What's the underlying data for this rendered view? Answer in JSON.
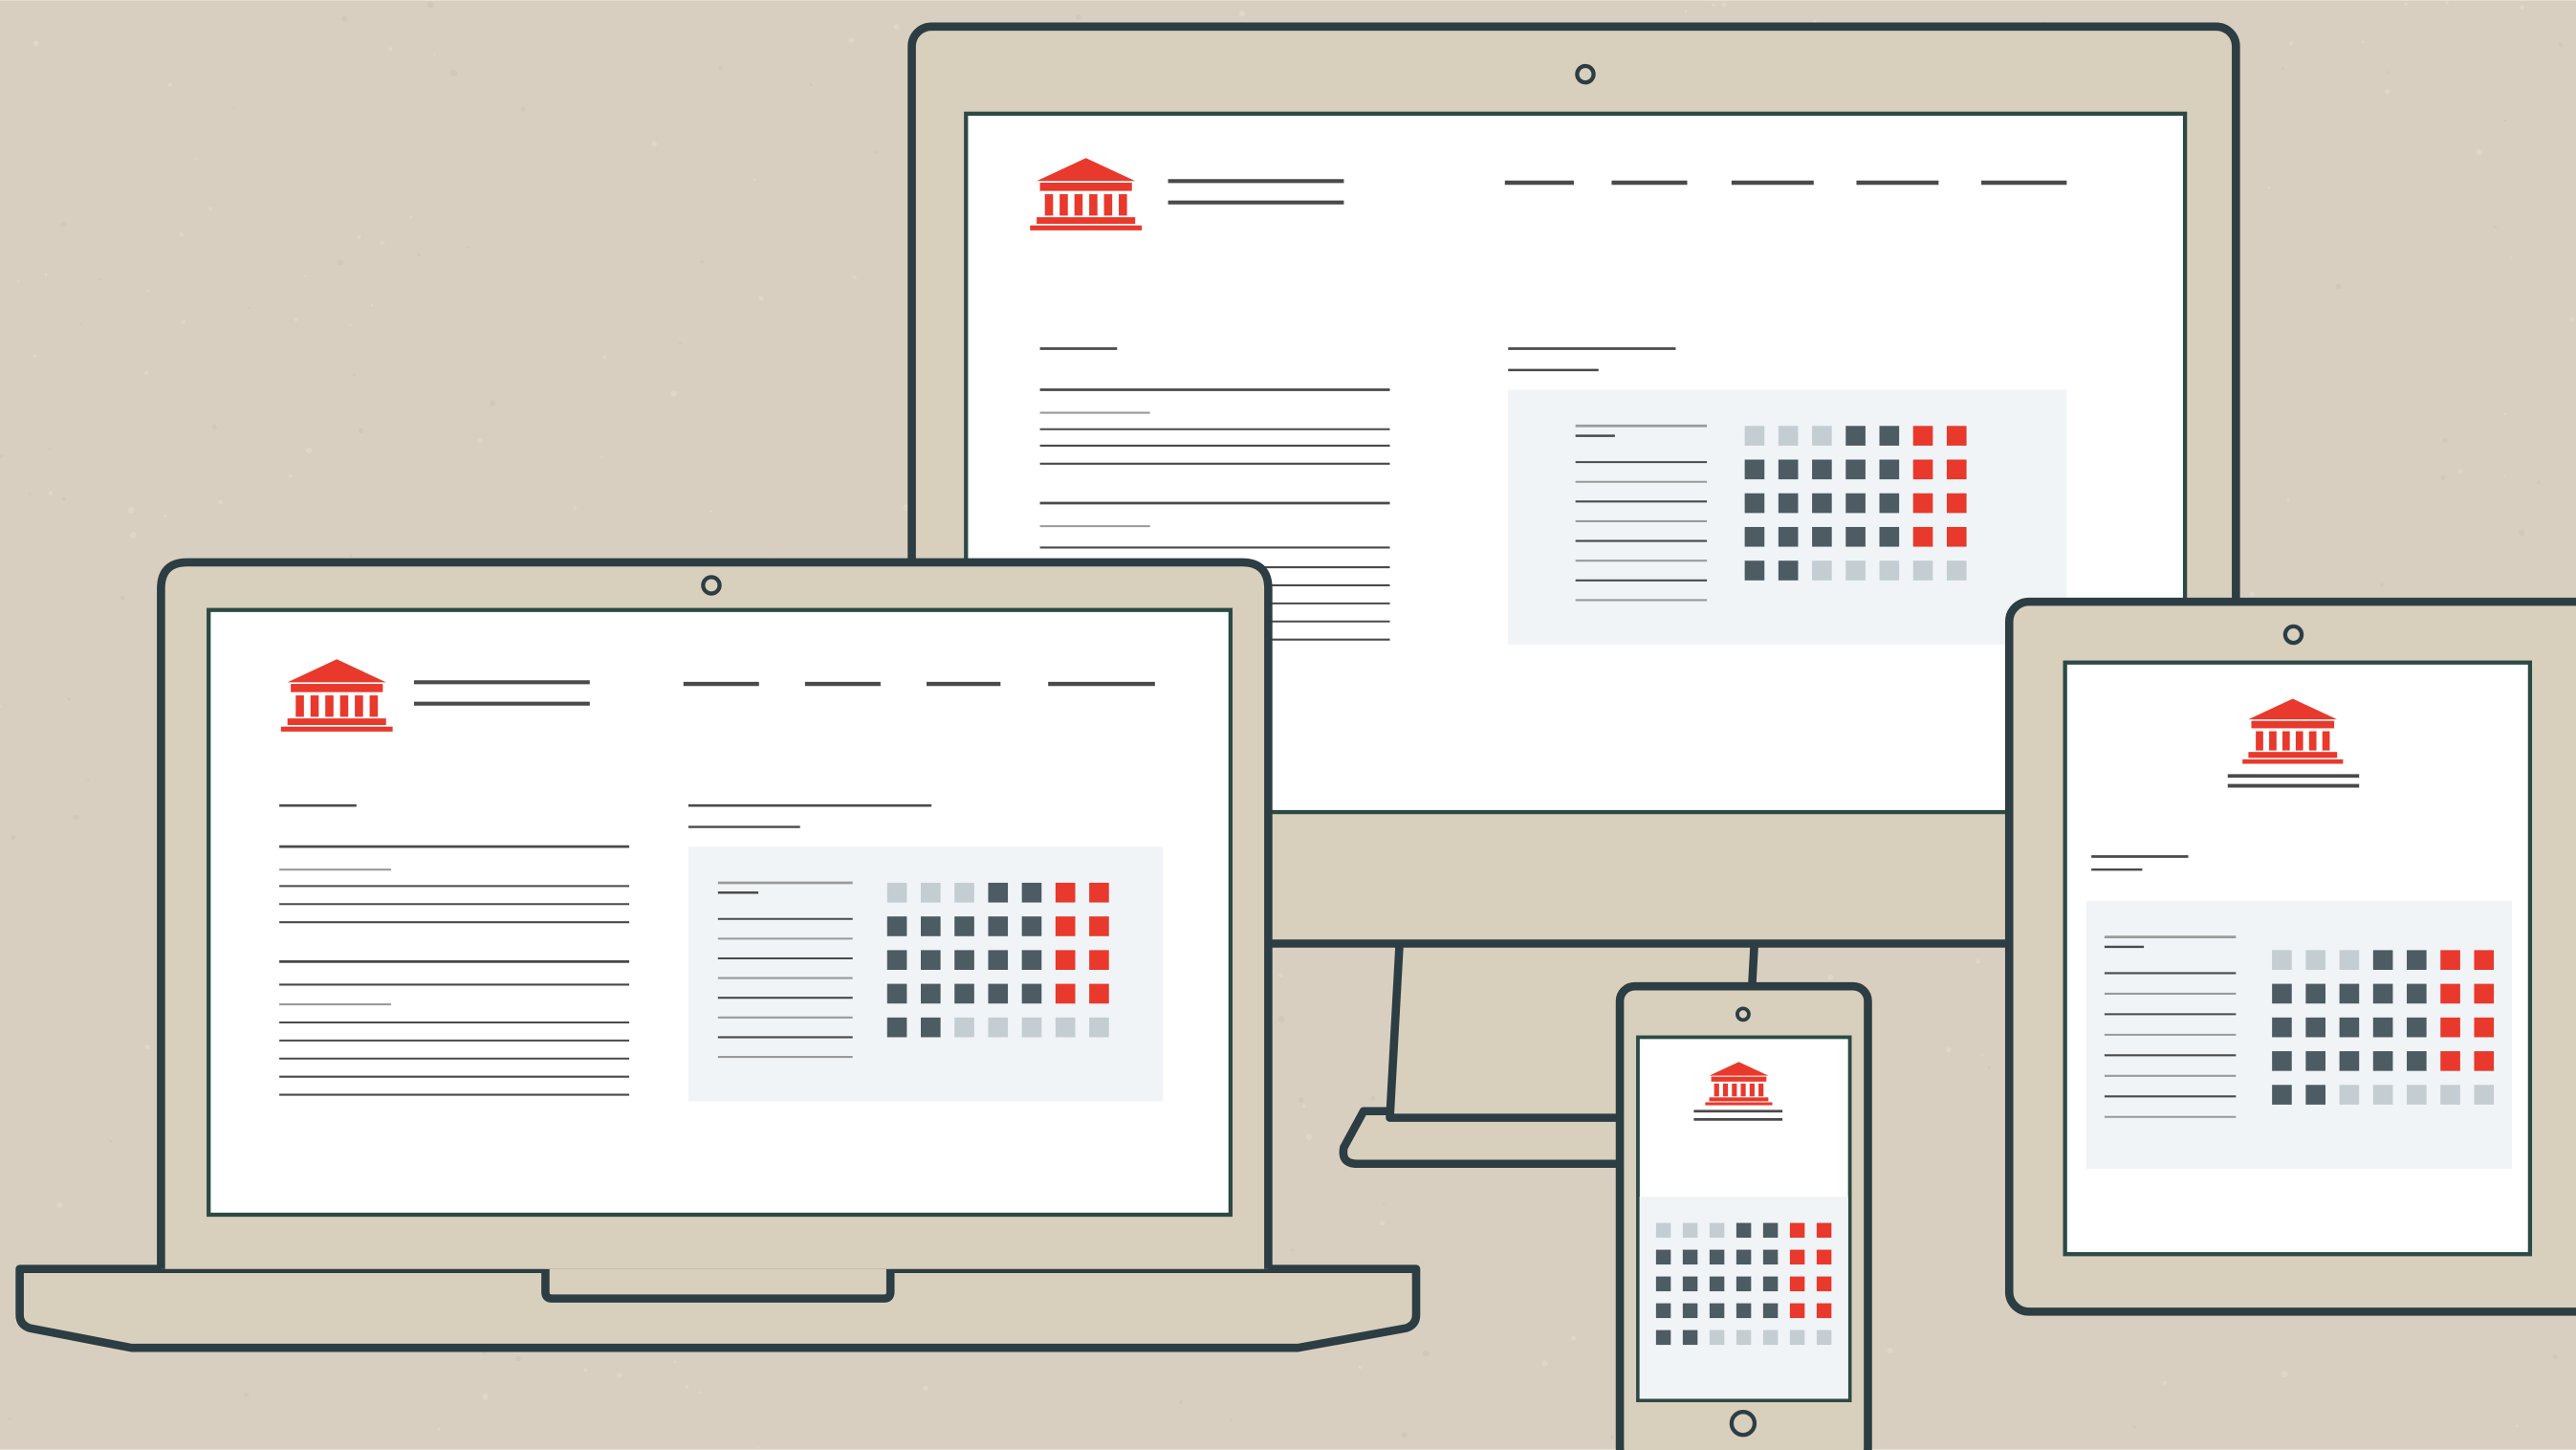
{
  "colors": {
    "background": "#d9cfc1",
    "device_body": "#d8cfbc",
    "outline": "#2c3d44",
    "screen": "#ffffff",
    "panel": "#f0f4f7",
    "accent": "#e8392c",
    "square_dark": "#4d5b63",
    "square_light": "#c4cdd2",
    "line": "#4a4a4a",
    "line_light": "#9a9a9a"
  },
  "icons": {
    "logo": "bank-building-icon",
    "camera": "camera-dot-icon",
    "home_button": "home-button-icon"
  },
  "devices": [
    "desktop-monitor",
    "laptop",
    "tablet",
    "phone"
  ],
  "calendar_grid": {
    "rows": [
      [
        "light",
        "light",
        "light",
        "dark",
        "dark",
        "red",
        "red"
      ],
      [
        "dark",
        "dark",
        "dark",
        "dark",
        "dark",
        "red",
        "red"
      ],
      [
        "dark",
        "dark",
        "dark",
        "dark",
        "dark",
        "red",
        "red"
      ],
      [
        "dark",
        "dark",
        "dark",
        "dark",
        "dark",
        "red",
        "red"
      ],
      [
        "dark",
        "dark",
        "light",
        "light",
        "light",
        "light",
        "light"
      ]
    ]
  }
}
